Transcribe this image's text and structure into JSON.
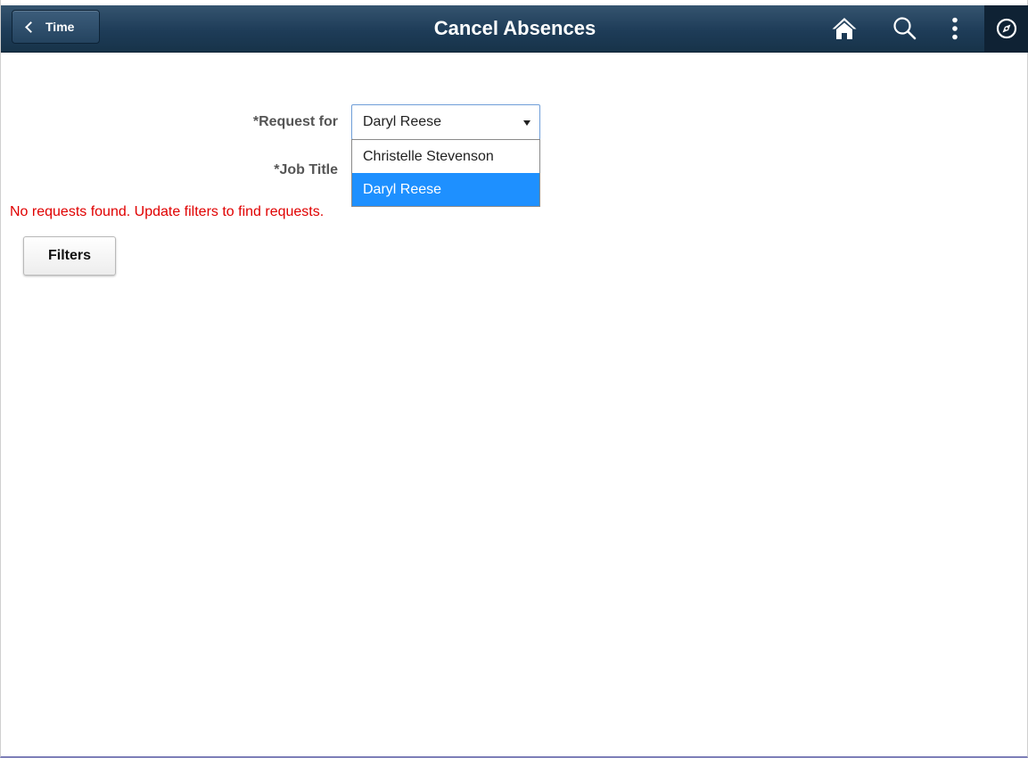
{
  "header": {
    "back_label": "Time",
    "title": "Cancel Absences",
    "icons": {
      "home": "home-icon",
      "search": "search-icon",
      "actions": "more-vertical-icon",
      "navbar": "compass-icon"
    },
    "colors": {
      "bar": "#1e3c58",
      "navbar_box": "#0f2234"
    }
  },
  "form": {
    "request_for": {
      "label": "*Request for",
      "selected": "Daryl Reese",
      "options": [
        "Christelle Stevenson",
        "Daryl Reese"
      ],
      "highlighted_option": "Daryl Reese"
    },
    "job_title": {
      "label": "*Job Title"
    }
  },
  "message": {
    "text": "No requests found. Update filters to find requests.",
    "color": "#e00000"
  },
  "filters_button": {
    "label": "Filters"
  }
}
